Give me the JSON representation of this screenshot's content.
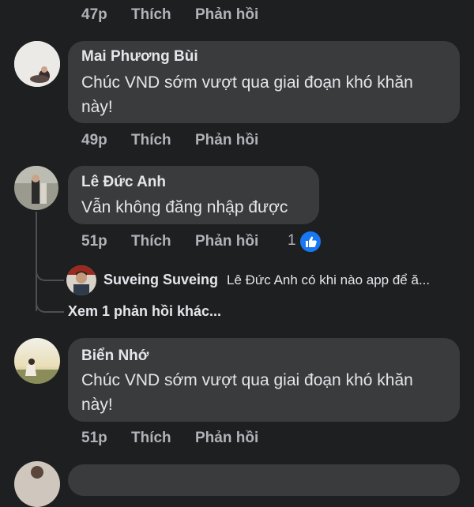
{
  "top_meta": {
    "time": "47p",
    "like": "Thích",
    "reply": "Phản hồi"
  },
  "comments": [
    {
      "author": "Mai Phương Bùi",
      "text_line1": "Chúc VND sớm vượt qua giai đoạn khó khăn",
      "text_line2": "này!",
      "time": "49p",
      "like": "Thích",
      "reply": "Phản hồi"
    },
    {
      "author": "Lê Đức Anh",
      "text_line1": "Vẫn không đăng nhập được",
      "time": "51p",
      "like": "Thích",
      "reply": "Phản hồi",
      "reaction_count": "1",
      "reply_preview": {
        "author": "Suveing Suveing",
        "text": "Lê Đức Anh có khi nào app  để ă..."
      },
      "more_replies": "Xem 1 phản hồi khác..."
    },
    {
      "author": "Biển Nhớ",
      "text_line1": "Chúc VND sớm vượt qua giai đoạn khó khăn",
      "text_line2": "này!",
      "time": "51p",
      "like": "Thích",
      "reply": "Phản hồi"
    }
  ],
  "colors": {
    "background": "#1e1f21",
    "bubble": "#3a3b3c",
    "meta_text": "#b0b3b8",
    "like_reaction": "#1877f2"
  },
  "icons": {
    "reaction": "like-reaction-icon"
  }
}
